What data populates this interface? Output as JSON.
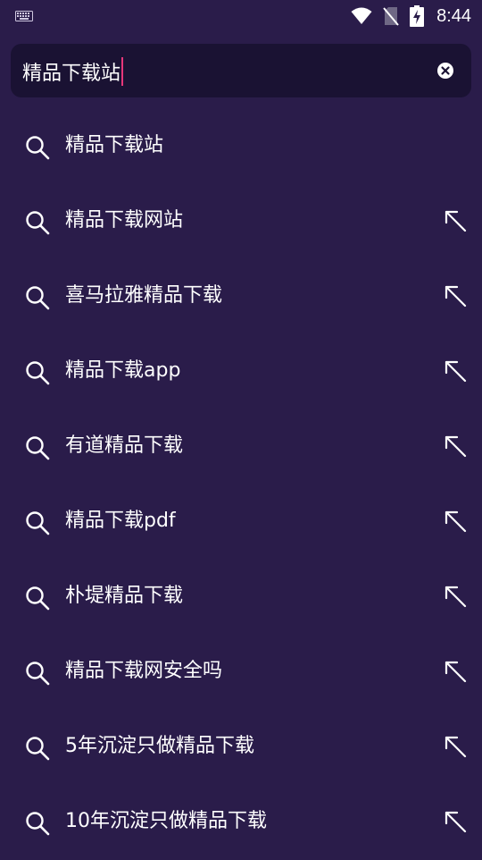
{
  "status_bar": {
    "time": "8:44",
    "icons": [
      "keyboard-icon",
      "wifi-icon",
      "no-sim-icon",
      "battery-charging-icon"
    ]
  },
  "search": {
    "value": "精品下载站",
    "clear_icon": "clear-icon"
  },
  "suggestions": [
    {
      "label": "精品下载站",
      "has_fill_arrow": false
    },
    {
      "label": "精品下载网站",
      "has_fill_arrow": true
    },
    {
      "label": "喜马拉雅精品下载",
      "has_fill_arrow": true
    },
    {
      "label": "精品下载app",
      "has_fill_arrow": true
    },
    {
      "label": "有道精品下载",
      "has_fill_arrow": true
    },
    {
      "label": "精品下载pdf",
      "has_fill_arrow": true
    },
    {
      "label": "朴堤精品下载",
      "has_fill_arrow": true
    },
    {
      "label": "精品下载网安全吗",
      "has_fill_arrow": true
    },
    {
      "label": "5年沉淀只做精品下载",
      "has_fill_arrow": true
    },
    {
      "label": "10年沉淀只做精品下载",
      "has_fill_arrow": true
    }
  ],
  "colors": {
    "background": "#2a1c4a",
    "search_box": "#1a1233",
    "caret": "#e6377a",
    "text": "#ffffff"
  }
}
